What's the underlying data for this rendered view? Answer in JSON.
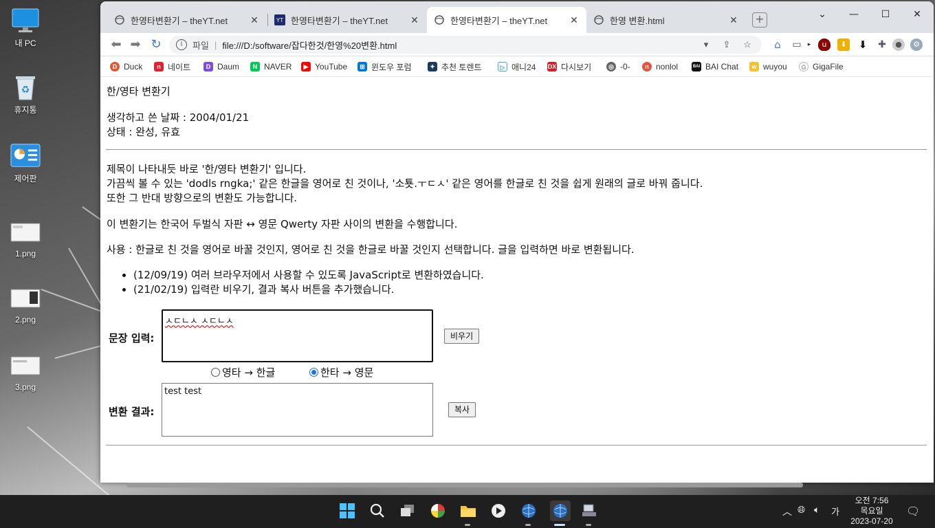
{
  "desktop": {
    "icons": [
      {
        "label": "내 PC"
      },
      {
        "label": "휴지통"
      },
      {
        "label": "제어판"
      },
      {
        "label": "1.png"
      },
      {
        "label": "2.png"
      },
      {
        "label": "3.png"
      }
    ]
  },
  "browser": {
    "tabs": [
      {
        "title": "한영타변환기 – theYT.net",
        "icon": "globe-icon"
      },
      {
        "title": "한영타변환기 – theYT.net",
        "icon": "yt-logo-icon"
      },
      {
        "title": "한영타변환기 – theYT.net",
        "icon": "globe-icon"
      },
      {
        "title": "한영 변환.html",
        "icon": "globe-icon"
      }
    ],
    "address": {
      "scheme_label": "파일",
      "url": "file:///D:/software/잡다한것/한영%20변환.html"
    },
    "bookmarks": [
      {
        "label": "Duck",
        "color": "#de5833"
      },
      {
        "label": "네이트",
        "color": "#e5202d"
      },
      {
        "label": "Daum",
        "color": "#7b4dd8"
      },
      {
        "label": "NAVER",
        "color": "#03c75a"
      },
      {
        "label": "YouTube",
        "color": "#ff0000"
      },
      {
        "label": "윈도우 포럼",
        "color": "#0078d4"
      },
      {
        "label": "추천 토렌트",
        "color": "#1b3a5c"
      },
      {
        "label": "애니24",
        "color": "#4aa3df"
      },
      {
        "label": "다시보기",
        "color": "#d12028"
      },
      {
        "label": "-0-",
        "color": "#666666"
      },
      {
        "label": "nonlol",
        "color": "#e8533d"
      },
      {
        "label": "BAI Chat",
        "color": "#111111"
      },
      {
        "label": "wuyou",
        "color": "#f2c230"
      },
      {
        "label": "GigaFile",
        "color": "#bbbbbb"
      }
    ]
  },
  "page": {
    "heading": "한/영타 변환기",
    "date_line": "생각하고 쓴 날짜 : 2004/01/21",
    "status_line": "상태 : 완성, 유효",
    "desc1": "제목이 나타내듯 바로 '한/영타 변환기' 입니다.",
    "desc2": "가끔씩 볼 수 있는 'dodls rngka;' 같은 한글을 영어로 친 것이나, '소툣.ㅜㄷㅅ' 같은 영어를 한글로 친 것을 쉽게 원래의 글로 바꿔 줍니다.",
    "desc3": "또한 그 반대 방향으로의 변환도 가능합니다.",
    "desc4": "이 변환기는 한국어 두벌식 자판 ↔ 영문 Qwerty 자판 사이의 변환을 수행합니다.",
    "usage": "사용 : 한글로 친 것을 영어로 바꿀 것인지, 영어로 친 것을 한글로 바꿀 것인지 선택합니다. 글을 입력하면 바로 변환됩니다.",
    "changelog": [
      "(12/09/19) 여러 브라우저에서 사용할 수 있도록 JavaScript로 변환하였습니다.",
      "(21/02/19) 입력란 비우기, 결과 복사 버튼을 추가했습니다."
    ],
    "form": {
      "input_label": "문장 입력:",
      "input_value": "ㅅㄷㄴㅅ ㅅㄷㄴㅅ",
      "clear_button": "비우기",
      "radio_en_to_ko": "영타 → 한글",
      "radio_ko_to_en": "한타 → 영문",
      "selected": "ko_to_en",
      "result_label": "변환 결과:",
      "result_value": "test test",
      "copy_button": "복사"
    }
  },
  "taskbar": {
    "clock_time": "오전 7:56",
    "clock_day": "목요일",
    "clock_date": "2023-07-20",
    "ime": "가"
  }
}
